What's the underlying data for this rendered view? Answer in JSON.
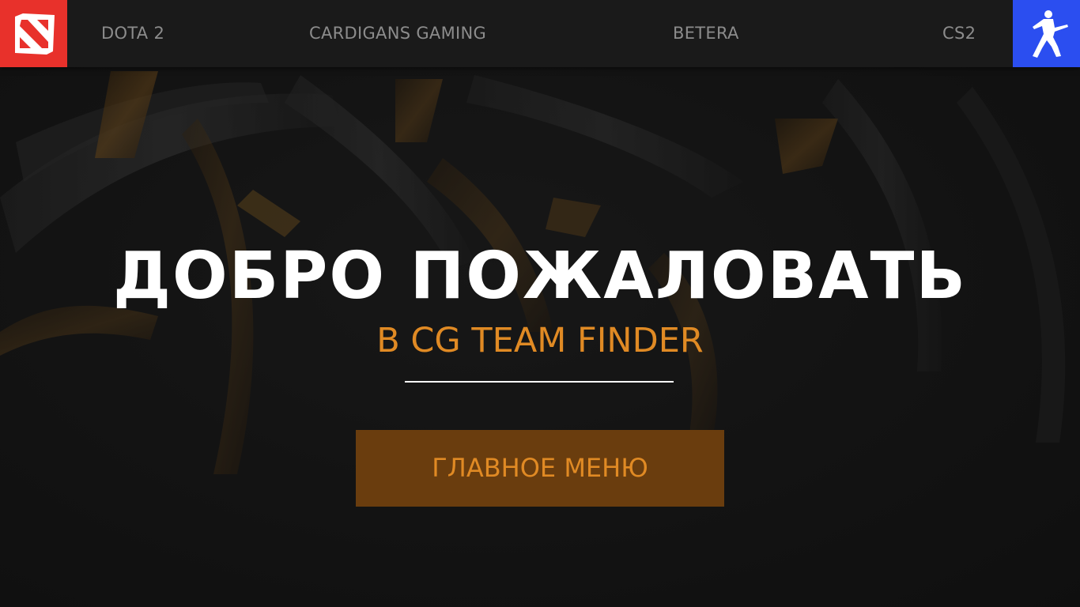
{
  "nav": {
    "items": [
      {
        "label": "DOTA 2"
      },
      {
        "label": "CARDIGANS GAMING"
      },
      {
        "label": "BETERA"
      },
      {
        "label": "CS2"
      }
    ],
    "left_logo_icon": "dota2-logo-icon",
    "right_logo_icon": "cs2-logo-icon"
  },
  "hero": {
    "title": "ДОБРО ПОЖАЛОВАТЬ",
    "subtitle": "В CG TEAM FINDER",
    "button_label": "ГЛАВНОЕ МЕНЮ"
  },
  "colors": {
    "accent": "#e08a24",
    "button_bg": "#6a3d0e",
    "dota_red": "#e8312b",
    "cs_blue": "#2b4ef0",
    "nav_bg": "#1a1a1a",
    "page_bg": "#121212"
  }
}
